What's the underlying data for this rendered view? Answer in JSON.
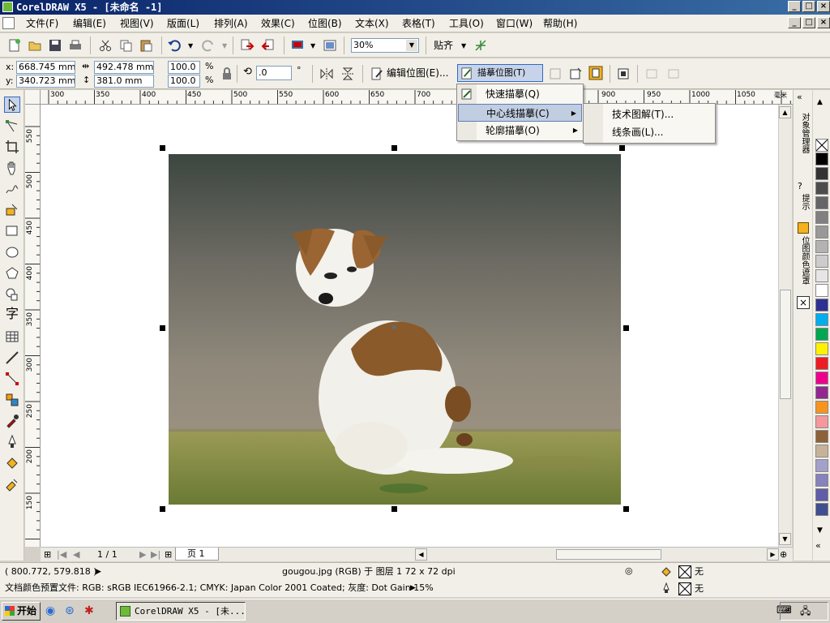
{
  "window": {
    "title": "CorelDRAW X5 - [未命名 -1]"
  },
  "menubar": {
    "items": [
      "文件(F)",
      "编辑(E)",
      "视图(V)",
      "版面(L)",
      "排列(A)",
      "效果(C)",
      "位图(B)",
      "文本(X)",
      "表格(T)",
      "工具(O)",
      "窗口(W)",
      "帮助(H)"
    ]
  },
  "toolbar": {
    "zoom": "30%",
    "snap_label": "贴齐"
  },
  "propertybar": {
    "x": "668.745 mm",
    "y": "340.723 mm",
    "w": "492.478 mm",
    "h": "381.0 mm",
    "scale_x": "100.0",
    "scale_y": "100.0",
    "scale_unit": "%",
    "angle": ".0",
    "angle_unit": "°",
    "edit_bitmap": "编辑位图(E)...",
    "trace_bitmap": "描摹位图(T)"
  },
  "trace_menu": {
    "items": [
      {
        "label": "快速描摹(Q)",
        "submenu": false
      },
      {
        "label": "中心线描摹(C)",
        "submenu": true
      },
      {
        "label": "轮廓描摹(O)",
        "submenu": true
      }
    ],
    "submenu": [
      "技术图解(T)...",
      "线条画(L)..."
    ]
  },
  "ruler": {
    "h": [
      "300",
      "350",
      "400",
      "450",
      "500",
      "550",
      "600",
      "650",
      "700",
      "900",
      "950",
      "1000",
      "1050"
    ],
    "h_unit": "毫米",
    "v": [
      "550",
      "500",
      "450",
      "400",
      "350",
      "300",
      "250",
      "200",
      "150"
    ]
  },
  "tools": [
    "pointer-tool",
    "shape-tool",
    "crop-tool",
    "zoom-tool",
    "freehand-tool",
    "smart-fill-tool",
    "rectangle-tool",
    "ellipse-tool",
    "polygon-tool",
    "basic-shapes-tool",
    "text-tool",
    "table-tool",
    "dimension-tool",
    "connector-tool",
    "blend-tool",
    "eyedropper-tool",
    "outline-tool",
    "fill-tool",
    "interactive-fill-tool"
  ],
  "pages": {
    "counter": "1 / 1",
    "tab": "页 1"
  },
  "docker": {
    "tabs": [
      "对象管理器",
      "提示",
      "位图颜色遮罩"
    ]
  },
  "palette": {
    "colors": [
      "#000000",
      "#333333",
      "#4d4d4d",
      "#666666",
      "#808080",
      "#999999",
      "#b3b3b3",
      "#cccccc",
      "#e6e6e6",
      "#ffffff",
      "#2e3192",
      "#00aeef",
      "#00a651",
      "#fff200",
      "#ed1c24",
      "#ec008c",
      "#92278f",
      "#f7941d",
      "#f5989d",
      "#8c6239",
      "#c7b299",
      "#a3a0c9",
      "#8781bd",
      "#605ca8",
      "#3f4f8f"
    ]
  },
  "status": {
    "coords": "( 800.772, 579.818 )",
    "object_info": "gougou.jpg (RGB) 于 图层 1 72 x 72 dpi",
    "color_profile": "文档颜色预置文件: RGB: sRGB IEC61966-2.1; CMYK: Japan Color 2001 Coated; 灰度: Dot Gain 15%",
    "fill_label": "无",
    "outline_label": "无"
  },
  "taskbar": {
    "start": "开始",
    "task": "CorelDRAW X5 - [未..."
  }
}
